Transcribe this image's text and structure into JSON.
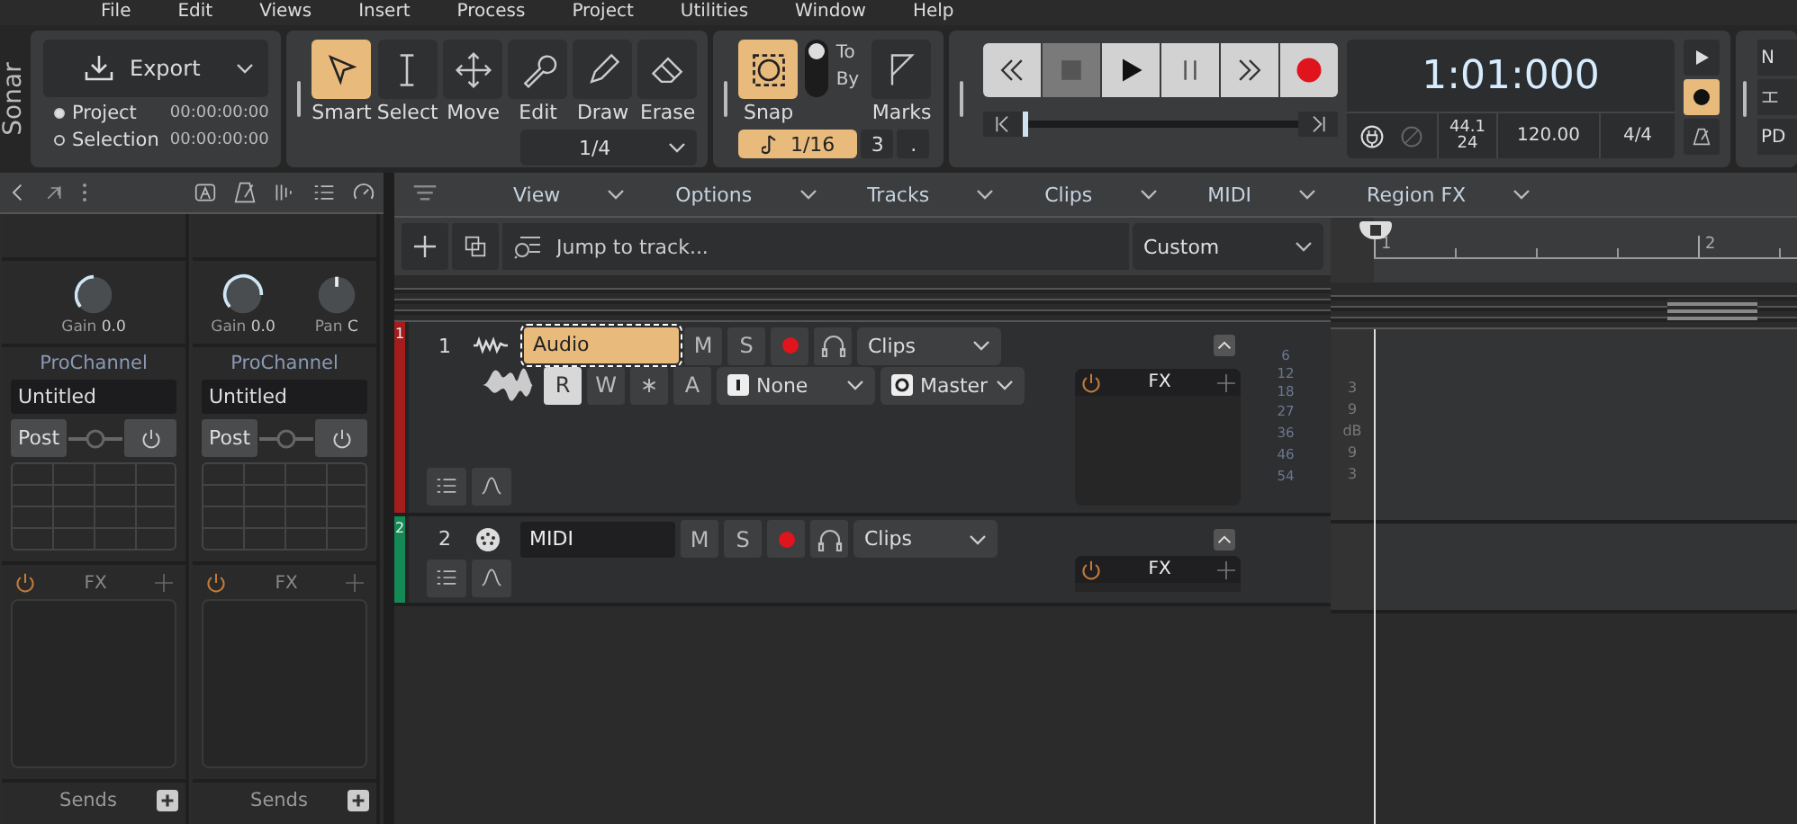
{
  "menu": [
    "File",
    "Edit",
    "Views",
    "Insert",
    "Process",
    "Project",
    "Utilities",
    "Window",
    "Help"
  ],
  "logo": "Sonar",
  "export": {
    "label": "Export",
    "ranges": [
      {
        "label": "Project",
        "time": "00:00:00:00",
        "selected": true
      },
      {
        "label": "Selection",
        "time": "00:00:00:00",
        "selected": false
      }
    ]
  },
  "tools": [
    {
      "kind": "smart",
      "label": "Smart",
      "selected": true
    },
    {
      "kind": "select",
      "label": "Select",
      "selected": false
    },
    {
      "kind": "move",
      "label": "Move",
      "selected": false
    },
    {
      "kind": "edit",
      "label": "Edit",
      "selected": false
    },
    {
      "kind": "draw",
      "label": "Draw",
      "selected": false
    },
    {
      "kind": "erase",
      "label": "Erase",
      "selected": false
    }
  ],
  "tool_resolution": "1/4",
  "snap": {
    "label": "Snap",
    "on": true,
    "by_mode": false,
    "to": "To",
    "by": "By",
    "marks": "Marks",
    "resolution": "1/16",
    "count": "3",
    "dot": "."
  },
  "transport": {
    "buttons": [
      {
        "kind": "rewind",
        "selected": false
      },
      {
        "kind": "stop",
        "selected": true
      },
      {
        "kind": "play",
        "selected": false
      },
      {
        "kind": "pause",
        "selected": false
      },
      {
        "kind": "forward",
        "selected": false
      },
      {
        "kind": "record",
        "selected": false
      }
    ],
    "position": {
      "level": 0.0
    },
    "time": "1:01:000",
    "sample_rate": "44.1",
    "bit_depth": "24",
    "tempo": "120.00",
    "meter": "4/4",
    "record_mode_on": true
  },
  "right_panel": {
    "labels": [
      "N",
      "PD"
    ]
  },
  "inspector": {
    "strips": [
      {
        "gain_label": "Gain",
        "gain": "0.0",
        "prochannel": "ProChannel",
        "preset": "Untitled",
        "post": "Post",
        "fx": "FX",
        "sends": "Sends"
      },
      {
        "gain_label": "Gain",
        "gain": "0.0",
        "pan_label": "Pan",
        "pan": "C",
        "prochannel": "ProChannel",
        "preset": "Untitled",
        "post": "Post",
        "fx": "FX",
        "sends": "Sends"
      }
    ]
  },
  "track_menu": [
    "View",
    "Options",
    "Tracks",
    "Clips",
    "MIDI",
    "Region FX"
  ],
  "search": {
    "placeholder": "Jump to track..."
  },
  "preset_dropdown": "Custom",
  "ruler": [
    "1",
    "2"
  ],
  "tracks": [
    {
      "kind": "audio",
      "strip_number": "1",
      "number": "1",
      "name": "Audio",
      "selected": true,
      "color": "#a41d1d",
      "mute": "M",
      "solo": "S",
      "clips": "Clips",
      "automation": [
        {
          "label": "R",
          "on": true
        },
        {
          "label": "W",
          "on": false
        },
        {
          "label": "∗",
          "on": false
        },
        {
          "label": "A",
          "on": false
        }
      ],
      "input": "None",
      "output": "Master",
      "fx": "FX",
      "meter_scale": [
        "6",
        "12",
        "18",
        "27",
        "36",
        "46",
        "54"
      ],
      "db_scale": [
        "3",
        "9",
        "dB",
        "9",
        "3"
      ]
    },
    {
      "kind": "midi",
      "strip_number": "2",
      "number": "2",
      "name": "MIDI",
      "selected": false,
      "color": "#138a55",
      "mute": "M",
      "solo": "S",
      "clips": "Clips",
      "fx": "FX"
    }
  ]
}
